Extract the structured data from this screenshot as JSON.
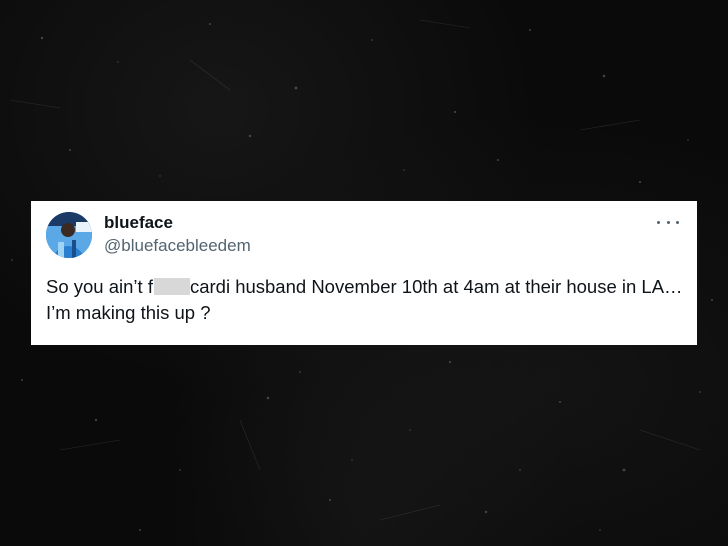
{
  "tweet": {
    "display_name": "blueface",
    "handle": "@bluefacebleedem",
    "text_part1": "So you ain’t f",
    "text_part2": "cardi husband November 10th at 4am at their house in LA…I’m making this up ?",
    "avatar_icon": "user-avatar-photo",
    "more_icon": "more-options-icon"
  },
  "colors": {
    "background": "#0a0a0a",
    "card": "#ffffff",
    "text_primary": "#0f1419",
    "text_secondary": "#536471"
  }
}
